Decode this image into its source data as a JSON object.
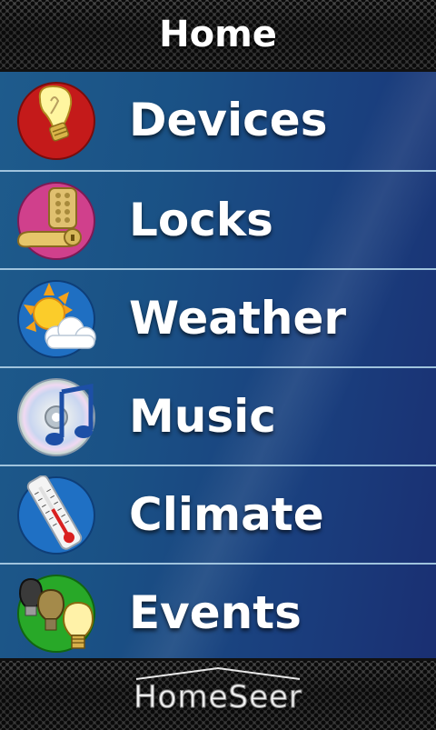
{
  "header": {
    "title": "Home"
  },
  "menu": {
    "items": [
      {
        "label": "Devices",
        "icon": "lightbulb-icon"
      },
      {
        "label": "Locks",
        "icon": "door-lock-icon"
      },
      {
        "label": "Weather",
        "icon": "sun-cloud-icon"
      },
      {
        "label": "Music",
        "icon": "music-cd-icon"
      },
      {
        "label": "Climate",
        "icon": "thermometer-icon"
      },
      {
        "label": "Events",
        "icon": "bulbs-icon"
      }
    ]
  },
  "footer": {
    "logo_text": "HomeSeer"
  },
  "colors": {
    "list_background": "#1a4a85",
    "divider": "#9fc3dd",
    "text": "#ffffff"
  }
}
